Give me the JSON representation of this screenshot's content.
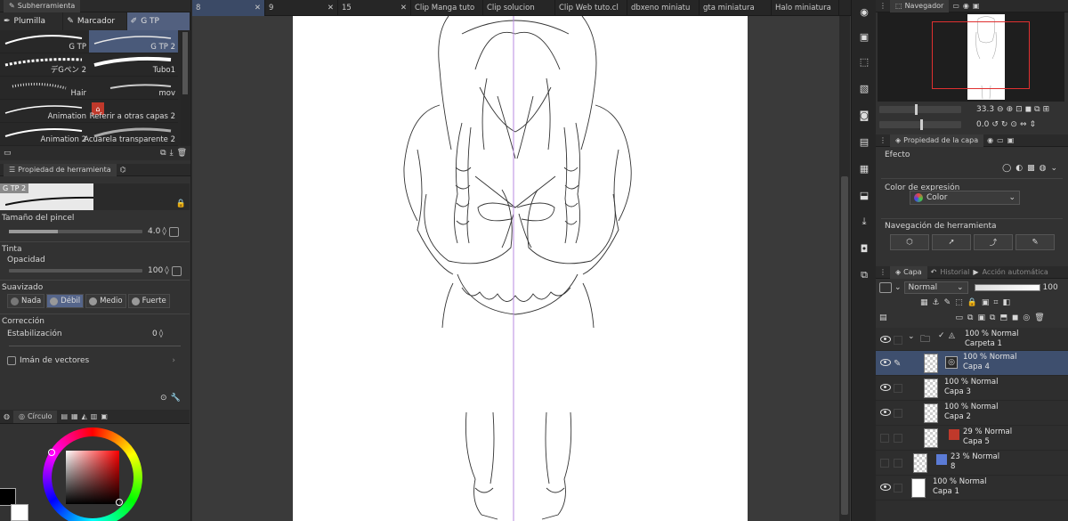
{
  "sub_tool_panel": {
    "title": "Subherramienta",
    "groups": [
      {
        "label": "Plumilla",
        "active": false
      },
      {
        "label": "Marcador",
        "active": false
      },
      {
        "label": "G TP",
        "active": true
      }
    ],
    "brushes": [
      {
        "name": "G TP",
        "selected": false
      },
      {
        "name": "G TP 2",
        "selected": true
      },
      {
        "name": "デGペン 2",
        "selected": false
      },
      {
        "name": "Tubo1",
        "selected": false
      },
      {
        "name": "Hair",
        "selected": false
      },
      {
        "name": "mov",
        "selected": false
      },
      {
        "name": "Animation",
        "selected": false
      },
      {
        "name": "Referir a otras capas 2",
        "selected": false
      },
      {
        "name": "Animation 2",
        "selected": false
      },
      {
        "name": "Acuarela transparente 2",
        "selected": false
      }
    ]
  },
  "tool_property": {
    "title": "Propiedad de herramienta",
    "current_tool": "G TP 2",
    "brush_size_label": "Tamaño del pincel",
    "brush_size_value": "4.0",
    "ink_label": "Tinta",
    "opacity_label": "Opacidad",
    "opacity_value": "100",
    "smoothing_label": "Suavizado",
    "smoothing_options": [
      {
        "label": "Nada",
        "active": false
      },
      {
        "label": "Débil",
        "active": true
      },
      {
        "label": "Medio",
        "active": false
      },
      {
        "label": "Fuerte",
        "active": false
      }
    ],
    "correction_label": "Corrección",
    "stabilization_label": "Estabilización",
    "stabilization_value": "0",
    "vector_magnet_label": "Imán de vectores"
  },
  "color_panel": {
    "title": "Círculo",
    "main_color": "#000000",
    "sub_color": "#ffffff"
  },
  "document_tabs": [
    {
      "label": "8",
      "active": true
    },
    {
      "label": "9",
      "active": false
    },
    {
      "label": "15",
      "active": false
    },
    {
      "label": "Clip Manga tuto",
      "active": false
    },
    {
      "label": "Clip solucion",
      "active": false
    },
    {
      "label": "Clip Web tuto.cl",
      "active": false
    },
    {
      "label": "dbxeno miniatu",
      "active": false
    },
    {
      "label": "gta miniatura",
      "active": false
    },
    {
      "label": "Halo miniatura",
      "active": false
    }
  ],
  "navigator": {
    "title": "Navegador",
    "zoom": "33.3",
    "rotation": "0.0"
  },
  "layer_property": {
    "title": "Propiedad de la capa",
    "effect_label": "Efecto",
    "expression_color_label": "Color de expresión",
    "expression_color_value": "Color",
    "tool_navigation_label": "Navegación de herramienta"
  },
  "layer_panel": {
    "tabs": [
      "Capa",
      "Historial",
      "Acción automática"
    ],
    "blend_mode": "Normal",
    "opacity": "100",
    "layers": [
      {
        "mode": "100 % Normal",
        "name": "Carpeta 1",
        "folder": true,
        "visible": true,
        "selected": false,
        "indent": 0
      },
      {
        "mode": "100 % Normal",
        "name": "Capa 4",
        "folder": false,
        "visible": true,
        "selected": true,
        "indent": 1
      },
      {
        "mode": "100 % Normal",
        "name": "Capa 3",
        "folder": false,
        "visible": true,
        "selected": false,
        "indent": 1
      },
      {
        "mode": "100 % Normal",
        "name": "Capa 2",
        "folder": false,
        "visible": true,
        "selected": false,
        "indent": 1
      },
      {
        "mode": "29 % Normal",
        "name": "Capa 5",
        "folder": false,
        "visible": false,
        "selected": false,
        "indent": 1
      },
      {
        "mode": "23 % Normal",
        "name": "8",
        "folder": false,
        "visible": false,
        "selected": false,
        "indent": 0
      },
      {
        "mode": "100 % Normal",
        "name": "Capa 1",
        "folder": false,
        "visible": true,
        "selected": false,
        "indent": 0
      }
    ]
  }
}
